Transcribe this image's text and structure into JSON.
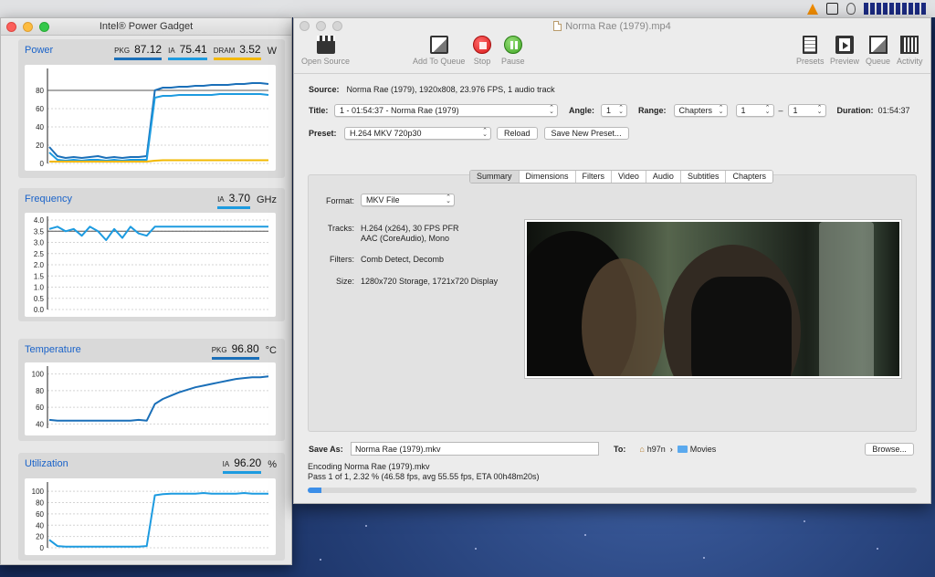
{
  "menubar": {
    "icons": [
      "vlc-icon",
      "nvidia-icon",
      "cat-icon",
      "battery-icon",
      "cpu-meter-icon"
    ]
  },
  "power_gadget": {
    "title": "Intel® Power Gadget",
    "panels": {
      "power": {
        "name": "Power",
        "metrics": [
          {
            "label": "PKG",
            "value": "87.12"
          },
          {
            "label": "IA",
            "value": "75.41"
          },
          {
            "label": "DRAM",
            "value": "3.52"
          }
        ],
        "unit": "W"
      },
      "frequency": {
        "name": "Frequency",
        "metrics": [
          {
            "label": "IA",
            "value": "3.70"
          }
        ],
        "unit": "GHz"
      },
      "temperature": {
        "name": "Temperature",
        "metrics": [
          {
            "label": "PKG",
            "value": "96.80"
          }
        ],
        "unit": "°C"
      },
      "utilization": {
        "name": "Utilization",
        "metrics": [
          {
            "label": "IA",
            "value": "96.20"
          }
        ],
        "unit": "%"
      }
    },
    "colors": {
      "pkg": "#1a6fb8",
      "ia": "#1d9be0",
      "dram": "#f2b800"
    }
  },
  "chart_data": [
    {
      "type": "line",
      "title": "Power",
      "yticks": [
        "80",
        "60",
        "40",
        "20",
        "0"
      ],
      "ylim": [
        0,
        100
      ],
      "limit_line": 80,
      "series": [
        {
          "name": "PKG",
          "values": [
            18,
            8,
            6,
            7,
            6,
            7,
            8,
            6,
            7,
            6,
            7,
            7,
            8,
            80,
            83,
            83,
            84,
            84,
            85,
            85,
            86,
            86,
            86,
            87,
            87,
            88,
            88,
            87
          ]
        },
        {
          "name": "IA",
          "values": [
            12,
            4,
            3,
            4,
            3,
            4,
            4,
            3,
            4,
            3,
            4,
            4,
            4,
            72,
            74,
            74,
            75,
            75,
            75,
            75,
            75,
            76,
            76,
            76,
            76,
            76,
            76,
            75
          ]
        },
        {
          "name": "DRAM",
          "values": [
            2,
            2,
            2,
            2,
            2,
            2,
            2,
            2,
            2,
            2,
            2,
            2,
            2,
            3,
            3.5,
            3.5,
            3.5,
            3.5,
            3.5,
            3.5,
            3.5,
            3.5,
            3.5,
            3.5,
            3.5,
            3.5,
            3.5,
            3.5
          ]
        }
      ]
    },
    {
      "type": "line",
      "title": "Frequency",
      "yticks": [
        "4.0",
        "3.5",
        "3.0",
        "2.5",
        "2.0",
        "1.5",
        "1.0",
        "0.5",
        "0.0"
      ],
      "ylim": [
        0,
        4.0
      ],
      "limit_line": 3.5,
      "series": [
        {
          "name": "IA",
          "values": [
            3.6,
            3.7,
            3.5,
            3.6,
            3.3,
            3.7,
            3.5,
            3.1,
            3.6,
            3.2,
            3.7,
            3.4,
            3.3,
            3.7,
            3.7,
            3.7,
            3.7,
            3.7,
            3.7,
            3.7,
            3.7,
            3.7,
            3.7,
            3.7,
            3.7,
            3.7,
            3.7,
            3.7
          ]
        }
      ]
    },
    {
      "type": "line",
      "title": "Temperature",
      "yticks": [
        "100",
        "80",
        "60",
        "40"
      ],
      "ylim": [
        35,
        105
      ],
      "series": [
        {
          "name": "PKG",
          "values": [
            45,
            44,
            44,
            44,
            44,
            44,
            44,
            44,
            44,
            44,
            44,
            45,
            44,
            64,
            70,
            74,
            78,
            81,
            84,
            86,
            88,
            90,
            92,
            94,
            95,
            96,
            96,
            97
          ]
        }
      ]
    },
    {
      "type": "line",
      "title": "Utilization",
      "yticks": [
        "100",
        "80",
        "60",
        "40",
        "20",
        "0"
      ],
      "ylim": [
        0,
        110
      ],
      "series": [
        {
          "name": "IA",
          "values": [
            14,
            3,
            2,
            2,
            2,
            2,
            2,
            2,
            2,
            2,
            2,
            2,
            3,
            93,
            95,
            96,
            96,
            96,
            96,
            97,
            96,
            96,
            96,
            96,
            97,
            96,
            96,
            96
          ]
        }
      ]
    }
  ],
  "handbrake": {
    "title": "Norma Rae (1979).mp4",
    "toolbar": {
      "open_source": "Open Source",
      "add_to_queue": "Add To Queue",
      "stop": "Stop",
      "pause": "Pause",
      "presets": "Presets",
      "preview": "Preview",
      "queue": "Queue",
      "activity": "Activity"
    },
    "source": {
      "label": "Source:",
      "value": "Norma Rae (1979), 1920x808, 23.976 FPS, 1 audio track"
    },
    "title_row": {
      "label": "Title:",
      "value": "1 - 01:54:37 - Norma Rae (1979)",
      "angle_label": "Angle:",
      "angle_value": "1",
      "range_label": "Range:",
      "range_value": "Chapters",
      "range_start": "1",
      "range_dash": "–",
      "range_end": "1",
      "duration_label": "Duration:",
      "duration_value": "01:54:37"
    },
    "preset": {
      "label": "Preset:",
      "value": "H.264 MKV 720p30",
      "reload": "Reload",
      "save_new": "Save New Preset..."
    },
    "tabs": [
      "Summary",
      "Dimensions",
      "Filters",
      "Video",
      "Audio",
      "Subtitles",
      "Chapters"
    ],
    "active_tab": "Summary",
    "summary": {
      "format_label": "Format:",
      "format_value": "MKV File",
      "tracks_label": "Tracks:",
      "tracks_line1": "H.264 (x264), 30 FPS PFR",
      "tracks_line2": "AAC (CoreAudio), Mono",
      "filters_label": "Filters:",
      "filters_value": "Comb Detect, Decomb",
      "size_label": "Size:",
      "size_value": "1280x720 Storage, 1721x720 Display"
    },
    "save": {
      "label": "Save As:",
      "value": "Norma Rae (1979).mkv",
      "to_label": "To:",
      "path_home": "h97n",
      "path_sep": "›",
      "path_folder": "Movies",
      "browse": "Browse..."
    },
    "status_line1": "Encoding Norma Rae (1979).mkv",
    "status_line2": "Pass 1 of 1, 2.32 % (46.58 fps, avg 55.55 fps, ETA 00h48m20s)",
    "progress": 0.0232
  }
}
